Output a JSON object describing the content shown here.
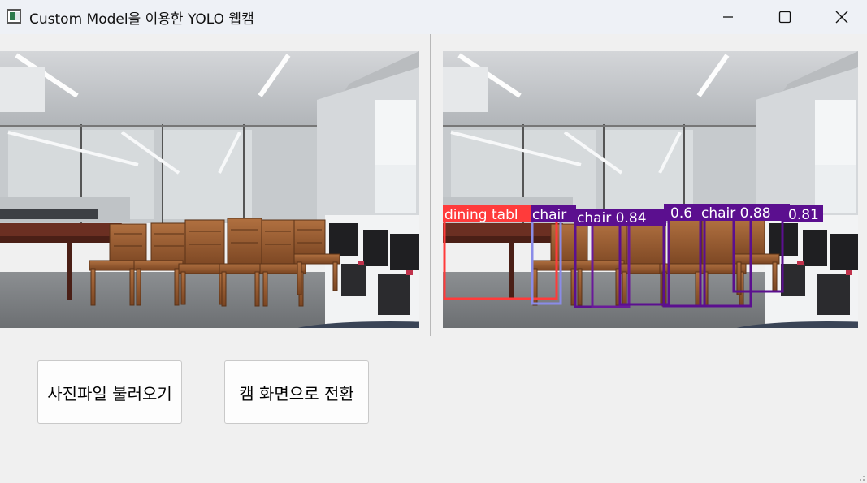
{
  "window": {
    "title": "Custom Model을 이용한 YOLO 웹캠",
    "icon": "app-window-icon",
    "controls": [
      "minimize-icon",
      "maximize-icon",
      "close-icon"
    ]
  },
  "detections": [
    {
      "label": "dining table",
      "visible_text": "dining  tabl",
      "color": "#ff3b3b"
    },
    {
      "label": "chair",
      "visible_text": "chair",
      "color": "#5b0f8f"
    },
    {
      "label": "chair",
      "visible_text": "chair  0.84",
      "color": "#5b0f8f"
    },
    {
      "label": "chair",
      "visible_text": "0.6",
      "color": "#5b0f8f"
    },
    {
      "label": "chair",
      "visible_text": "chair  0.88",
      "color": "#5b0f8f"
    },
    {
      "label": "chair",
      "visible_text": "0.81",
      "color": "#5b0f8f"
    }
  ],
  "buttons": {
    "load_photo": "사진파일 불러오기",
    "switch_webcam": "캠 화면으로 전환"
  },
  "colors": {
    "table_box": "#ff3b3b",
    "chair_box": "#5b0f8f",
    "window_bg": "#f0f0f0",
    "titlebar_bg": "#eef1f6"
  }
}
